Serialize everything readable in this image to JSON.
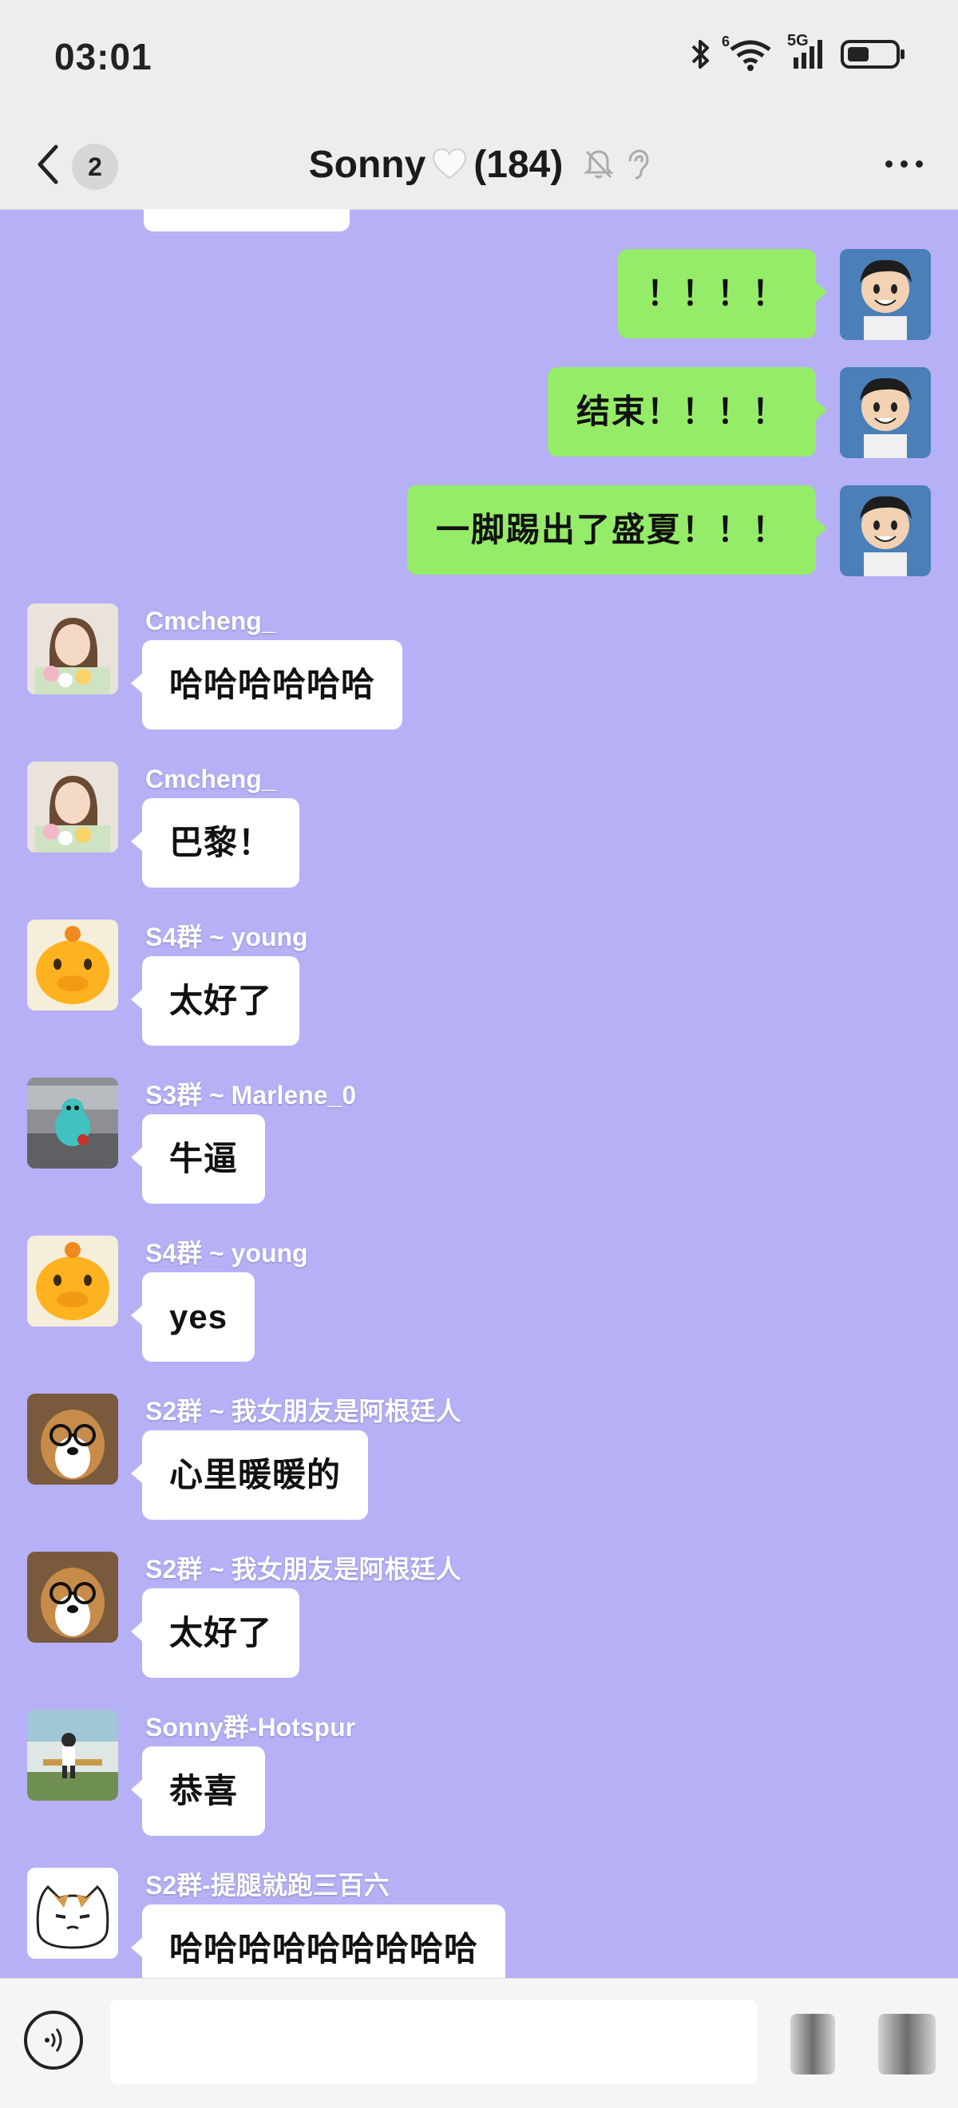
{
  "status_bar": {
    "time": "03:01",
    "network_label": "5G",
    "wifi_label": "6"
  },
  "header": {
    "title": "Sonny",
    "member_count": "(184)",
    "unread_count": "2"
  },
  "outgoing": [
    {
      "text": "！！！！"
    },
    {
      "text": "结束！！！！"
    },
    {
      "text": "一脚踢出了盛夏！！！"
    }
  ],
  "incoming": [
    {
      "sender": "Cmcheng_",
      "text": "哈哈哈哈哈哈",
      "avatar": "woman-with-flowers"
    },
    {
      "sender": "Cmcheng_",
      "text": "巴黎！",
      "avatar": "woman-with-flowers"
    },
    {
      "sender": "S4群 ~ young",
      "text": "太好了",
      "avatar": "yellow-duck"
    },
    {
      "sender": "S3群 ~ Marlene_0",
      "text": "牛逼",
      "avatar": "blue-plush-toy"
    },
    {
      "sender": "S4群 ~ young",
      "text": "yes",
      "avatar": "yellow-duck"
    },
    {
      "sender": "S2群 ~ 我女朋友是阿根廷人",
      "text": "心里暖暖的",
      "avatar": "dog-with-glasses"
    },
    {
      "sender": "S2群 ~ 我女朋友是阿根廷人",
      "text": "太好了",
      "avatar": "dog-with-glasses"
    },
    {
      "sender": "Sonny群-Hotspur",
      "text": "恭喜",
      "avatar": "child-photo"
    },
    {
      "sender": "S2群-提腿就跑三百六",
      "text": "哈哈哈哈哈哈哈哈哈",
      "avatar": "cartoon-cat"
    }
  ],
  "input": {
    "placeholder": ""
  },
  "colors": {
    "chat_bg": "#b6b0f6",
    "outgoing_bubble": "#95ec69",
    "incoming_bubble": "#ffffff"
  }
}
